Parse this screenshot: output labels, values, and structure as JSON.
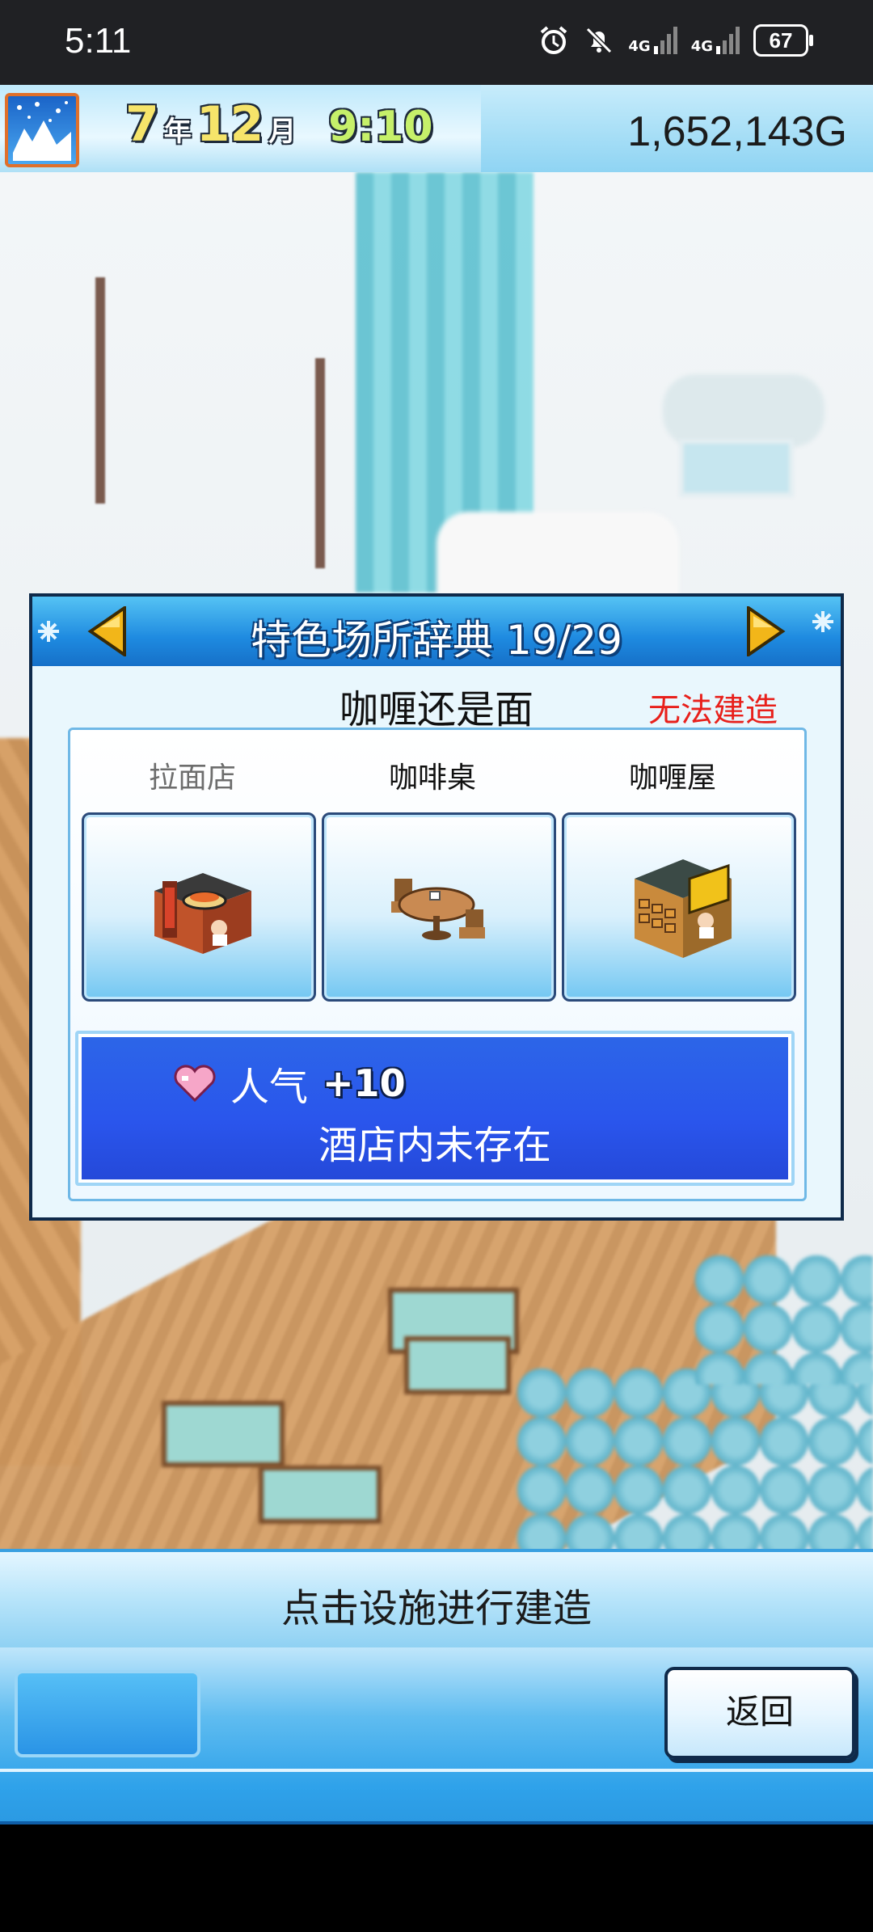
{
  "status_bar": {
    "time": "5:11",
    "network1": "4G",
    "network2": "4G",
    "battery": "67"
  },
  "hud": {
    "year": "7",
    "year_unit": "年",
    "month": "12",
    "month_unit": "月",
    "clock": "9:10",
    "money": "1,652,143G"
  },
  "dialog": {
    "title": "特色场所辞典 19/29",
    "subtitle": "咖喱还是面",
    "status": "无法建造",
    "status_color": "#e8201b",
    "items": [
      {
        "label": "拉面店",
        "icon": "ramen-shop-icon",
        "available": false
      },
      {
        "label": "咖啡桌",
        "icon": "cafe-table-icon",
        "available": true
      },
      {
        "label": "咖喱屋",
        "icon": "curry-house-icon",
        "available": true
      }
    ],
    "effect": {
      "label": "人气",
      "value": "+10",
      "icon": "heart-icon"
    },
    "info": "酒店内未存在"
  },
  "bottom": {
    "hint": "点击设施进行建造",
    "back_label": "返回"
  }
}
